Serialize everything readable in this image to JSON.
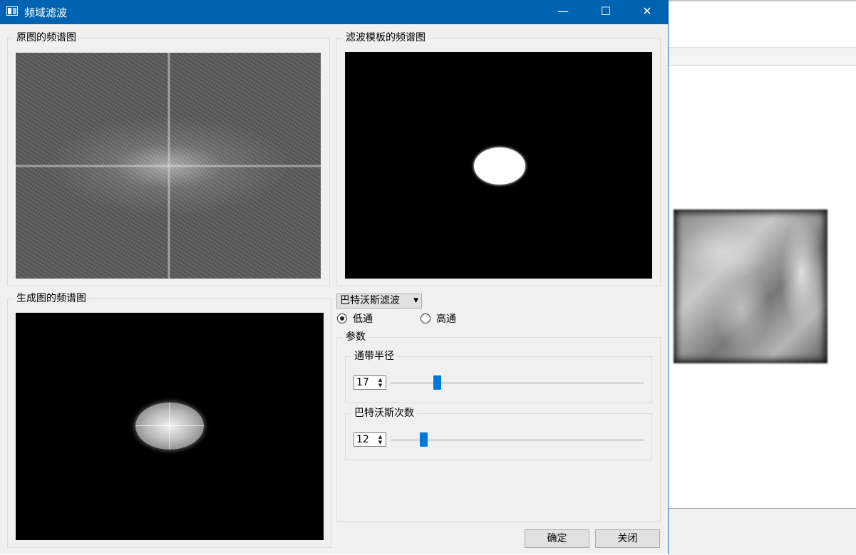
{
  "window": {
    "title": "频域滤波",
    "controls": {
      "minimize": "—",
      "maximize": "☐",
      "close": "✕"
    }
  },
  "panels": {
    "original_spectrum": {
      "label": "原图的频谱图"
    },
    "mask_spectrum": {
      "label": "滤波模板的频谱图"
    },
    "result_spectrum": {
      "label": "生成图的频谱图"
    }
  },
  "filter": {
    "type_selected": "巴特沃斯滤波",
    "dropdown_arrow": "▼",
    "modes": [
      {
        "label": "低通",
        "selected": true
      },
      {
        "label": "高通",
        "selected": false
      }
    ]
  },
  "params": {
    "label": "参数",
    "radius": {
      "label": "通带半径",
      "value": "17"
    },
    "order": {
      "label": "巴特沃斯次数",
      "value": "12"
    }
  },
  "spin_arrows": {
    "up": "▲",
    "down": "▼"
  },
  "buttons": {
    "ok": "确定",
    "close": "关闭"
  },
  "colors": {
    "titlebar": "#0063b1",
    "slider_handle": "#0078d7",
    "dialog_bg": "#f0f0f0"
  }
}
